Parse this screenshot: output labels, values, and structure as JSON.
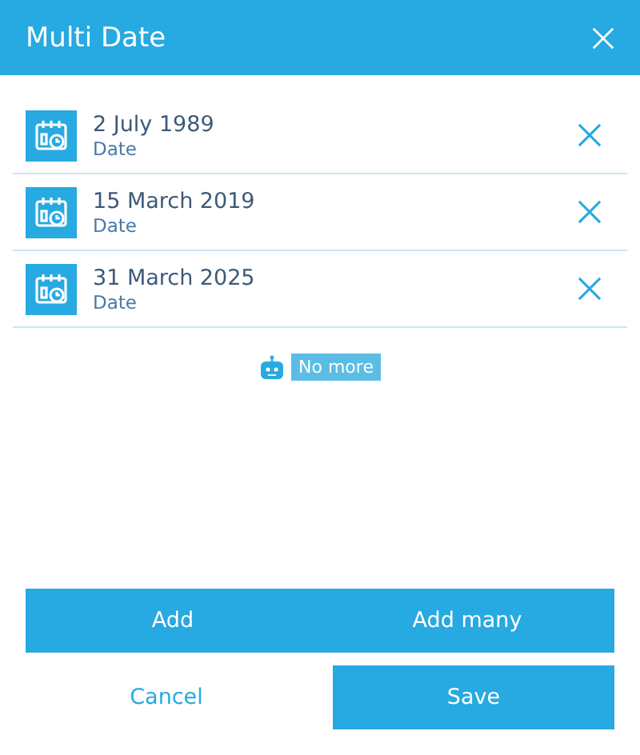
{
  "window": {
    "title": "Multi Date"
  },
  "items": [
    {
      "value": "2 July 1989",
      "label": "Date"
    },
    {
      "value": "15 March 2019",
      "label": "Date"
    },
    {
      "value": "31 March 2025",
      "label": "Date"
    }
  ],
  "end_message": "No more",
  "buttons": [
    {
      "label": "Add",
      "kind": "primary"
    },
    {
      "label": "Add many",
      "kind": "primary"
    }
  ],
  "footer_buttons": [
    {
      "label": "Cancel",
      "kind": "link"
    },
    {
      "label": "Save",
      "kind": "primary"
    }
  ]
}
